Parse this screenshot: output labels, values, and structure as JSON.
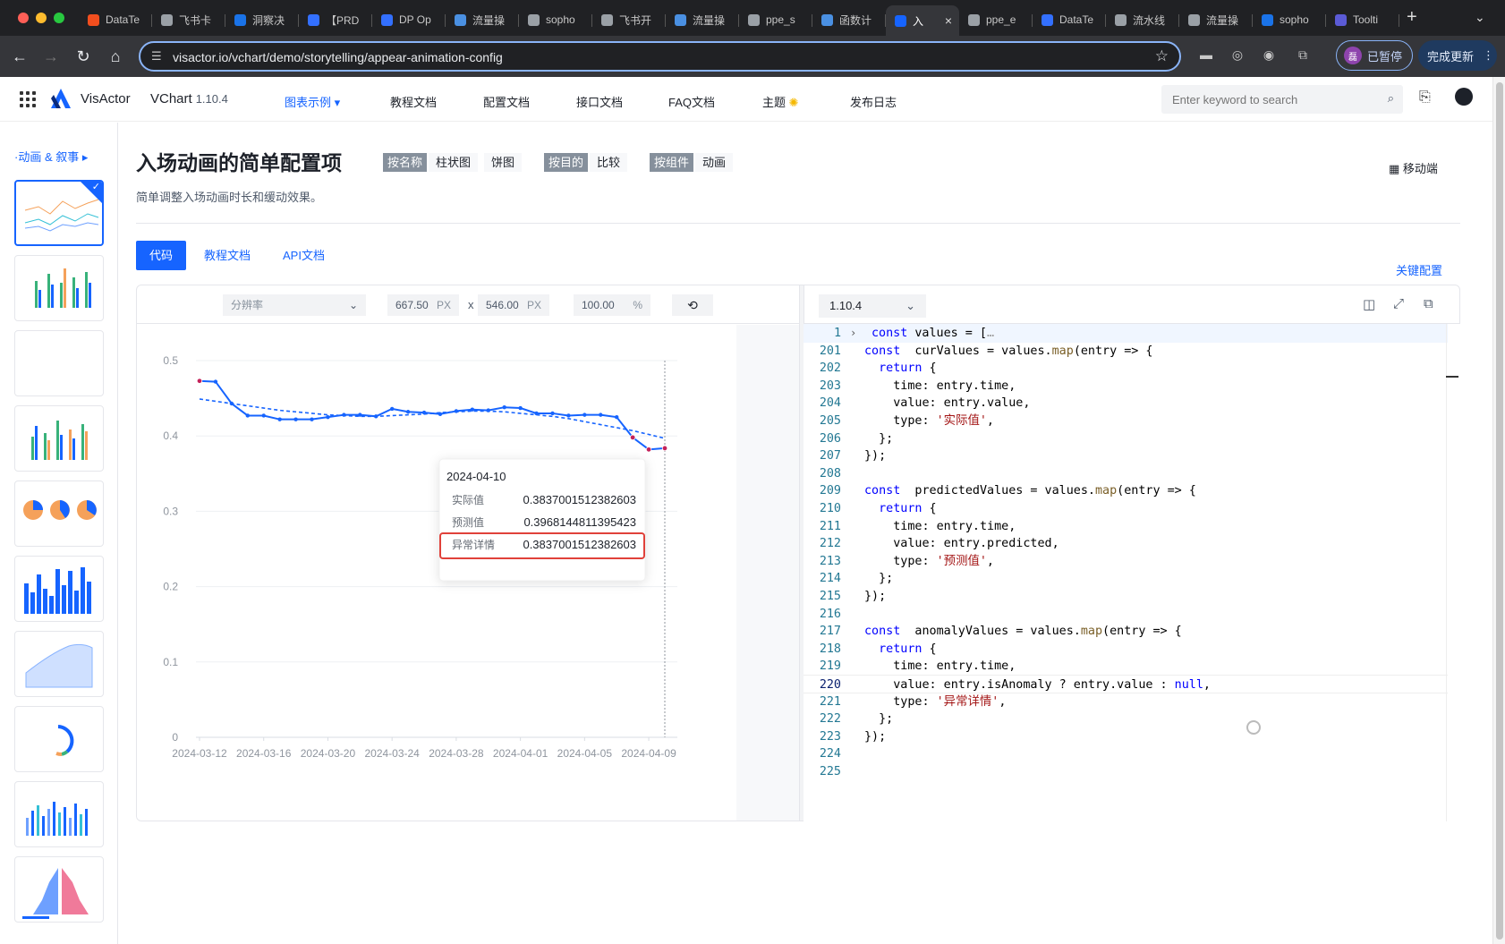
{
  "browser": {
    "tabs": [
      {
        "label": "DataTe",
        "color": "#f24e1e"
      },
      {
        "label": "飞书卡",
        "color": "#9aa0a6"
      },
      {
        "label": "洞察决",
        "color": "#1a73e8"
      },
      {
        "label": "【PRD",
        "color": "#3370ff"
      },
      {
        "label": "DP Op",
        "color": "#3370ff"
      },
      {
        "label": "流量操",
        "color": "#4a90e2"
      },
      {
        "label": "sopho",
        "color": "#9aa0a6"
      },
      {
        "label": "飞书开",
        "color": "#9aa0a6"
      },
      {
        "label": "流量操",
        "color": "#4a90e2"
      },
      {
        "label": "ppe_s",
        "color": "#9aa0a6"
      },
      {
        "label": "函数计",
        "color": "#4a90e2"
      },
      {
        "label": "入",
        "color": "#1664ff",
        "active": true
      },
      {
        "label": "ppe_e",
        "color": "#9aa0a6"
      },
      {
        "label": "DataTe",
        "color": "#3370ff"
      },
      {
        "label": "流水线",
        "color": "#9aa0a6"
      },
      {
        "label": "流量操",
        "color": "#9aa0a6"
      },
      {
        "label": "sopho",
        "color": "#1a73e8"
      },
      {
        "label": "Toolti",
        "color": "#5b5bd6"
      }
    ],
    "new_tab": "+",
    "url": "visactor.io/vchart/demo/storytelling/appear-animation-config",
    "profile_initial": "磊",
    "profile_label": "已暂停",
    "update_label": "完成更新"
  },
  "header": {
    "brand": "VisActor",
    "product": "VChart",
    "version": "1.10.4",
    "nav": [
      "图表示例 ▾",
      "教程文档",
      "配置文档",
      "接口文档",
      "FAQ文档",
      "主题",
      "发布日志"
    ],
    "search_placeholder": "Enter keyword to search"
  },
  "sidebar": {
    "section_title": "·动画 & 叙事 ▸"
  },
  "page": {
    "title": "入场动画的简单配置项",
    "tags": [
      {
        "key": "按名称",
        "values": [
          "柱状图",
          "饼图"
        ]
      },
      {
        "key": "按目的",
        "values": [
          "比较"
        ]
      },
      {
        "key": "按组件",
        "values": [
          "动画"
        ]
      }
    ],
    "mobile_label": "移动端",
    "description": "简单调整入场动画时长和缓动效果。",
    "doc_tabs": [
      "代码",
      "教程文档",
      "API文档"
    ],
    "key_config": "关键配置"
  },
  "preview_toolbar": {
    "resolution_placeholder": "分辨率",
    "width": "667.50",
    "height": "546.00",
    "unit_px": "PX",
    "times": "x",
    "zoom": "100.00",
    "unit_pct": "%"
  },
  "editor": {
    "version_select": "1.10.4"
  },
  "chart_data": {
    "type": "line",
    "x": [
      "2024-03-12",
      "2024-03-13",
      "2024-03-14",
      "2024-03-15",
      "2024-03-16",
      "2024-03-17",
      "2024-03-18",
      "2024-03-19",
      "2024-03-20",
      "2024-03-21",
      "2024-03-22",
      "2024-03-23",
      "2024-03-24",
      "2024-03-25",
      "2024-03-26",
      "2024-03-27",
      "2024-03-28",
      "2024-03-29",
      "2024-03-30",
      "2024-03-31",
      "2024-04-01",
      "2024-04-02",
      "2024-04-03",
      "2024-04-04",
      "2024-04-05",
      "2024-04-06",
      "2024-04-07",
      "2024-04-08",
      "2024-04-09",
      "2024-04-10"
    ],
    "x_tick_labels": [
      "2024-03-12",
      "2024-03-16",
      "2024-03-20",
      "2024-03-24",
      "2024-03-28",
      "2024-04-01",
      "2024-04-05",
      "2024-04-09"
    ],
    "series": [
      {
        "name": "实际值",
        "color": "#1664ff",
        "style": "solid",
        "values": [
          0.473,
          0.472,
          0.443,
          0.427,
          0.427,
          0.422,
          0.422,
          0.422,
          0.425,
          0.428,
          0.428,
          0.426,
          0.436,
          0.432,
          0.431,
          0.429,
          0.433,
          0.435,
          0.434,
          0.438,
          0.437,
          0.43,
          0.43,
          0.427,
          0.428,
          0.428,
          0.425,
          0.398,
          0.382,
          0.3837001512382603
        ]
      },
      {
        "name": "预测值",
        "color": "#1664ff",
        "style": "dashed",
        "values": [
          0.449,
          0.446,
          0.443,
          0.44,
          0.437,
          0.434,
          0.432,
          0.43,
          0.428,
          0.427,
          0.426,
          0.426,
          0.427,
          0.428,
          0.429,
          0.431,
          0.432,
          0.433,
          0.433,
          0.432,
          0.43,
          0.428,
          0.426,
          0.423,
          0.419,
          0.415,
          0.411,
          0.407,
          0.402,
          0.3968144811395423
        ]
      },
      {
        "name": "异常详情",
        "color": "#c4225a",
        "style": "points",
        "values": [
          0.473,
          null,
          null,
          null,
          null,
          null,
          null,
          null,
          null,
          null,
          null,
          null,
          null,
          null,
          null,
          null,
          null,
          null,
          null,
          null,
          null,
          null,
          null,
          null,
          null,
          null,
          null,
          0.398,
          0.382,
          0.3837001512382603
        ]
      }
    ],
    "y_ticks": [
      0,
      0.1,
      0.2,
      0.3,
      0.4,
      0.5
    ],
    "ylim": [
      0,
      0.5
    ],
    "grid": true,
    "tooltip": {
      "title": "2024-04-10",
      "rows": [
        {
          "label": "实际值",
          "value": "0.3837001512382603"
        },
        {
          "label": "预测值",
          "value": "0.3968144811395423"
        },
        {
          "label": "异常详情",
          "value": "0.3837001512382603",
          "highlighted": true
        }
      ]
    }
  },
  "code_lines": [
    {
      "n": "1",
      "fold": true,
      "first": true,
      "tokens": [
        [
          "k",
          "const"
        ],
        [
          "p",
          " values = ["
        ],
        [
          "ellip",
          "…"
        ]
      ]
    },
    {
      "n": "201",
      "tokens": [
        [
          "k",
          "const"
        ],
        [
          "p",
          "  curValues = values."
        ],
        [
          "f",
          "map"
        ],
        [
          "p",
          "(entry => {"
        ]
      ]
    },
    {
      "n": "202",
      "tokens": [
        [
          "p",
          "  "
        ],
        [
          "k",
          "return"
        ],
        [
          "p",
          " {"
        ]
      ]
    },
    {
      "n": "203",
      "tokens": [
        [
          "p",
          "    time: entry.time,"
        ]
      ]
    },
    {
      "n": "204",
      "tokens": [
        [
          "p",
          "    value: entry.value,"
        ]
      ]
    },
    {
      "n": "205",
      "tokens": [
        [
          "p",
          "    type: "
        ],
        [
          "s",
          "'实际值'"
        ],
        [
          "p",
          ","
        ]
      ]
    },
    {
      "n": "206",
      "tokens": [
        [
          "p",
          "  };"
        ]
      ]
    },
    {
      "n": "207",
      "tokens": [
        [
          "p",
          "});"
        ]
      ]
    },
    {
      "n": "208",
      "tokens": [
        [
          "p",
          ""
        ]
      ]
    },
    {
      "n": "209",
      "tokens": [
        [
          "k",
          "const"
        ],
        [
          "p",
          "  predictedValues = values."
        ],
        [
          "f",
          "map"
        ],
        [
          "p",
          "(entry => {"
        ]
      ]
    },
    {
      "n": "210",
      "tokens": [
        [
          "p",
          "  "
        ],
        [
          "k",
          "return"
        ],
        [
          "p",
          " {"
        ]
      ]
    },
    {
      "n": "211",
      "tokens": [
        [
          "p",
          "    time: entry.time,"
        ]
      ]
    },
    {
      "n": "212",
      "tokens": [
        [
          "p",
          "    value: entry.predicted,"
        ]
      ]
    },
    {
      "n": "213",
      "tokens": [
        [
          "p",
          "    type: "
        ],
        [
          "s",
          "'预测值'"
        ],
        [
          "p",
          ","
        ]
      ]
    },
    {
      "n": "214",
      "tokens": [
        [
          "p",
          "  };"
        ]
      ]
    },
    {
      "n": "215",
      "tokens": [
        [
          "p",
          "});"
        ]
      ]
    },
    {
      "n": "216",
      "tokens": [
        [
          "p",
          ""
        ]
      ]
    },
    {
      "n": "217",
      "tokens": [
        [
          "k",
          "const"
        ],
        [
          "p",
          "  anomalyValues = values."
        ],
        [
          "f",
          "map"
        ],
        [
          "p",
          "(entry => {"
        ]
      ]
    },
    {
      "n": "218",
      "tokens": [
        [
          "p",
          "  "
        ],
        [
          "k",
          "return"
        ],
        [
          "p",
          " {"
        ]
      ]
    },
    {
      "n": "219",
      "tokens": [
        [
          "p",
          "    time: entry.time,"
        ]
      ]
    },
    {
      "n": "220",
      "current": true,
      "tokens": [
        [
          "p",
          "    value: entry.isAnomaly ? entry.value : "
        ],
        [
          "k",
          "null"
        ],
        [
          "p",
          ","
        ]
      ]
    },
    {
      "n": "221",
      "tokens": [
        [
          "p",
          "    type: "
        ],
        [
          "s",
          "'异常详情'"
        ],
        [
          "p",
          ","
        ]
      ]
    },
    {
      "n": "222",
      "tokens": [
        [
          "p",
          "  };"
        ]
      ]
    },
    {
      "n": "223",
      "tokens": [
        [
          "p",
          "});"
        ]
      ]
    },
    {
      "n": "224",
      "tokens": [
        [
          "p",
          ""
        ]
      ]
    },
    {
      "n": "225",
      "tokens": [
        [
          "p",
          ""
        ]
      ]
    }
  ]
}
